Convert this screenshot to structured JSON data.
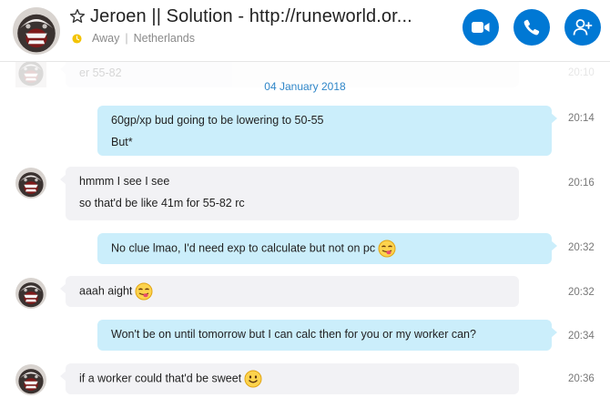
{
  "header": {
    "title": "Jeroen || Solution -  http://runeworld.or...",
    "status": "Away",
    "location": "Netherlands",
    "icons": {
      "favorite": "star-icon",
      "status": "away-clock-icon",
      "video": "video-camera-icon",
      "call": "phone-icon",
      "add": "add-person-icon"
    }
  },
  "chat": {
    "ghost_text": "er 55-82",
    "ghost_time": "20:10",
    "date_separator": "04 January 2018",
    "messages": [
      {
        "direction": "out",
        "lines": [
          "60gp/xp bud going to be lowering to 50-55",
          "But*"
        ],
        "time": "20:14"
      },
      {
        "direction": "in",
        "lines": [
          "hmmm I see I see",
          "so that'd be like 41m for 55-82 rc"
        ],
        "time": "20:16"
      },
      {
        "direction": "out",
        "lines": [
          "No clue lmao, I'd need exp to calculate but not on pc"
        ],
        "emoji": "tongue-wink-emoji",
        "time": "20:32"
      },
      {
        "direction": "in",
        "lines": [
          "aaah aight"
        ],
        "emoji": "tongue-wink-emoji",
        "time": "20:32"
      },
      {
        "direction": "out",
        "lines": [
          "Won't be on until tomorrow but I can calc then for you or my worker can?"
        ],
        "time": "20:34"
      },
      {
        "direction": "in",
        "lines": [
          "if a worker could that'd be sweet"
        ],
        "emoji": "smile-emoji",
        "time": "20:36"
      }
    ]
  },
  "colors": {
    "accent": "#0078d4",
    "outgoing_bubble": "#cbeefb",
    "incoming_bubble": "#f2f2f5",
    "date_text": "#2f86c8",
    "away": "#f3c300"
  }
}
